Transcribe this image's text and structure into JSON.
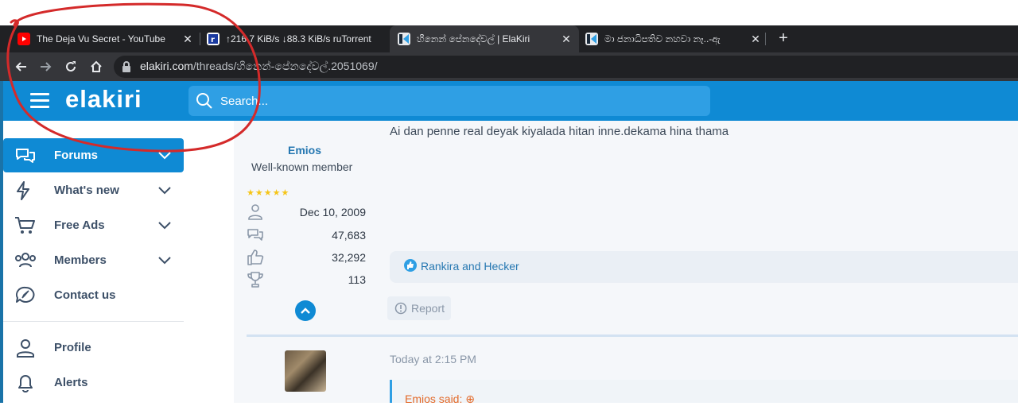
{
  "browser": {
    "tabs": [
      {
        "title": "The Deja Vu Secret - YouTube",
        "favicon": "youtube-icon",
        "active": false
      },
      {
        "title": "↑216.7 KiB/s ↓88.3 KiB/s ruTorrent",
        "favicon": "rutorrent-icon",
        "active": false
      },
      {
        "title": "හීනෙන් පේනදේවල් | ElaKiri",
        "favicon": "elakiri-icon",
        "active": true
      },
      {
        "title": "මා ජනාධිපතිව නහවා නෑ..-ඇ",
        "favicon": "elakiri-icon",
        "active": false
      }
    ],
    "new_tab": "+",
    "close_glyph": "✕",
    "url_domain": "elakiri.com",
    "url_path": "/threads/හීනෙන්-පේනදේවල්.2051069/"
  },
  "site": {
    "logo": "elakiri",
    "search_placeholder": "Search...",
    "brand_color": "#0f8ad4"
  },
  "sidebar": {
    "items": [
      {
        "label": "Forums",
        "icon": "forums-icon",
        "expandable": true,
        "active": true
      },
      {
        "label": "What's new",
        "icon": "lightning-icon",
        "expandable": true,
        "active": false
      },
      {
        "label": "Free Ads",
        "icon": "cart-icon",
        "expandable": true,
        "active": false
      },
      {
        "label": "Members",
        "icon": "members-icon",
        "expandable": true,
        "active": false
      },
      {
        "label": "Contact us",
        "icon": "contact-icon",
        "expandable": false,
        "active": false
      },
      {
        "label": "Profile",
        "icon": "user-icon",
        "expandable": false,
        "active": false
      },
      {
        "label": "Alerts",
        "icon": "bell-icon",
        "expandable": false,
        "active": false
      }
    ]
  },
  "post": {
    "author": "Emios",
    "author_title": "Well-known member",
    "stars": "★★★★★",
    "joined": "Dec 10, 2009",
    "messages": "47,683",
    "reactions": "32,292",
    "points": "113",
    "text": "Ai dan penne real deyak kiyalada hitan inne.dekama hina thama",
    "reacted_by": "Rankira and Hecker",
    "report_label": "Report"
  },
  "next_post": {
    "timestamp": "Today at 2:15 PM",
    "quote_author": "Emios said:"
  }
}
